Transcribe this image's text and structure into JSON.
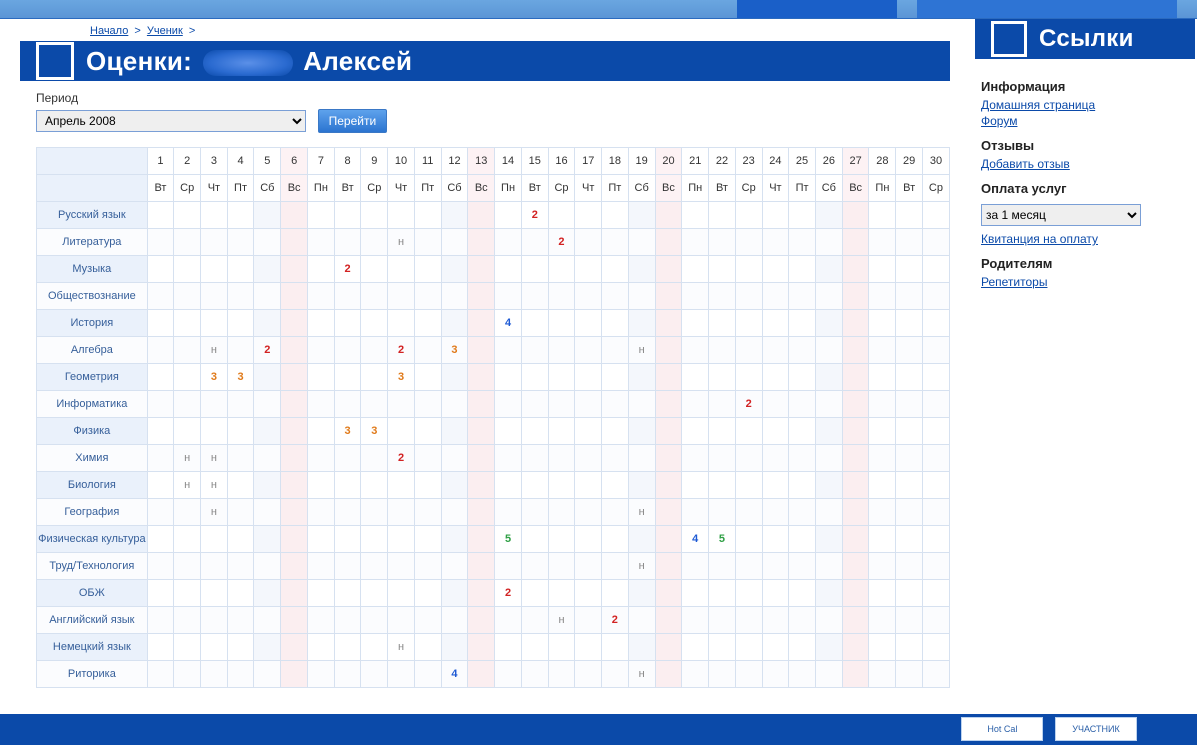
{
  "breadcrumb": {
    "home": "Начало",
    "student": "Ученик"
  },
  "title": {
    "prefix": "Оценки:",
    "name": "Алексей"
  },
  "period": {
    "label": "Период",
    "selected": "Апрель 2008",
    "go": "Перейти"
  },
  "days": [
    1,
    2,
    3,
    4,
    5,
    6,
    7,
    8,
    9,
    10,
    11,
    12,
    13,
    14,
    15,
    16,
    17,
    18,
    19,
    20,
    21,
    22,
    23,
    24,
    25,
    26,
    27,
    28,
    29,
    30
  ],
  "dow": [
    "Вт",
    "Ср",
    "Чт",
    "Пт",
    "Сб",
    "Вс",
    "Пн",
    "Вт",
    "Ср",
    "Чт",
    "Пт",
    "Сб",
    "Вс",
    "Пн",
    "Вт",
    "Ср",
    "Чт",
    "Пт",
    "Сб",
    "Вс",
    "Пн",
    "Вт",
    "Ср",
    "Чт",
    "Пт",
    "Сб",
    "Вс",
    "Пн",
    "Вт",
    "Ср"
  ],
  "weekend_days": [
    5,
    6,
    12,
    13,
    19,
    20,
    26,
    27
  ],
  "sunday_days": [
    6,
    13,
    20,
    27
  ],
  "subjects": [
    {
      "name": "Русский язык",
      "cells": {
        "15": "2"
      }
    },
    {
      "name": "Литература",
      "cells": {
        "10": "н",
        "16": "2"
      }
    },
    {
      "name": "Музыка",
      "cells": {
        "8": "2"
      }
    },
    {
      "name": "Обществознание",
      "cells": {}
    },
    {
      "name": "История",
      "cells": {
        "14": "4"
      }
    },
    {
      "name": "Алгебра",
      "cells": {
        "3": "н",
        "5": "2",
        "10": "2",
        "12": "3",
        "19": "н"
      }
    },
    {
      "name": "Геометрия",
      "cells": {
        "3": "3",
        "4": "3",
        "10": "3"
      }
    },
    {
      "name": "Информатика",
      "cells": {
        "23": "2"
      }
    },
    {
      "name": "Физика",
      "cells": {
        "8": "3",
        "9": "3"
      }
    },
    {
      "name": "Химия",
      "cells": {
        "2": "н",
        "3": "н",
        "10": "2"
      }
    },
    {
      "name": "Биология",
      "cells": {
        "2": "н",
        "3": "н"
      }
    },
    {
      "name": "География",
      "cells": {
        "3": "н",
        "19": "н"
      }
    },
    {
      "name": "Физическая культура",
      "cells": {
        "14": "5",
        "12": "",
        "21": "4",
        "22": "5"
      }
    },
    {
      "name": "Труд/Технология",
      "cells": {
        "19": "н"
      }
    },
    {
      "name": "ОБЖ",
      "cells": {
        "14": "2"
      }
    },
    {
      "name": "Английский язык",
      "cells": {
        "16": "н",
        "18": "2"
      }
    },
    {
      "name": "Немецкий язык",
      "cells": {
        "10": "н"
      }
    },
    {
      "name": "Риторика",
      "cells": {
        "12": "4",
        "19": "н"
      }
    }
  ],
  "sidebar": {
    "title": "Ссылки",
    "info": {
      "head": "Информация",
      "home": "Домашняя страница",
      "forum": "Форум"
    },
    "reviews": {
      "head": "Отзывы",
      "add": "Добавить отзыв"
    },
    "pay": {
      "head": "Оплата услуг",
      "period": "за 1 месяц",
      "receipt": "Квитанция на оплату"
    },
    "parents": {
      "head": "Родителям",
      "tutors": "Репетиторы"
    }
  },
  "footer": {
    "badge1": "Hot Cal",
    "badge2": "УЧАСТНИК"
  }
}
